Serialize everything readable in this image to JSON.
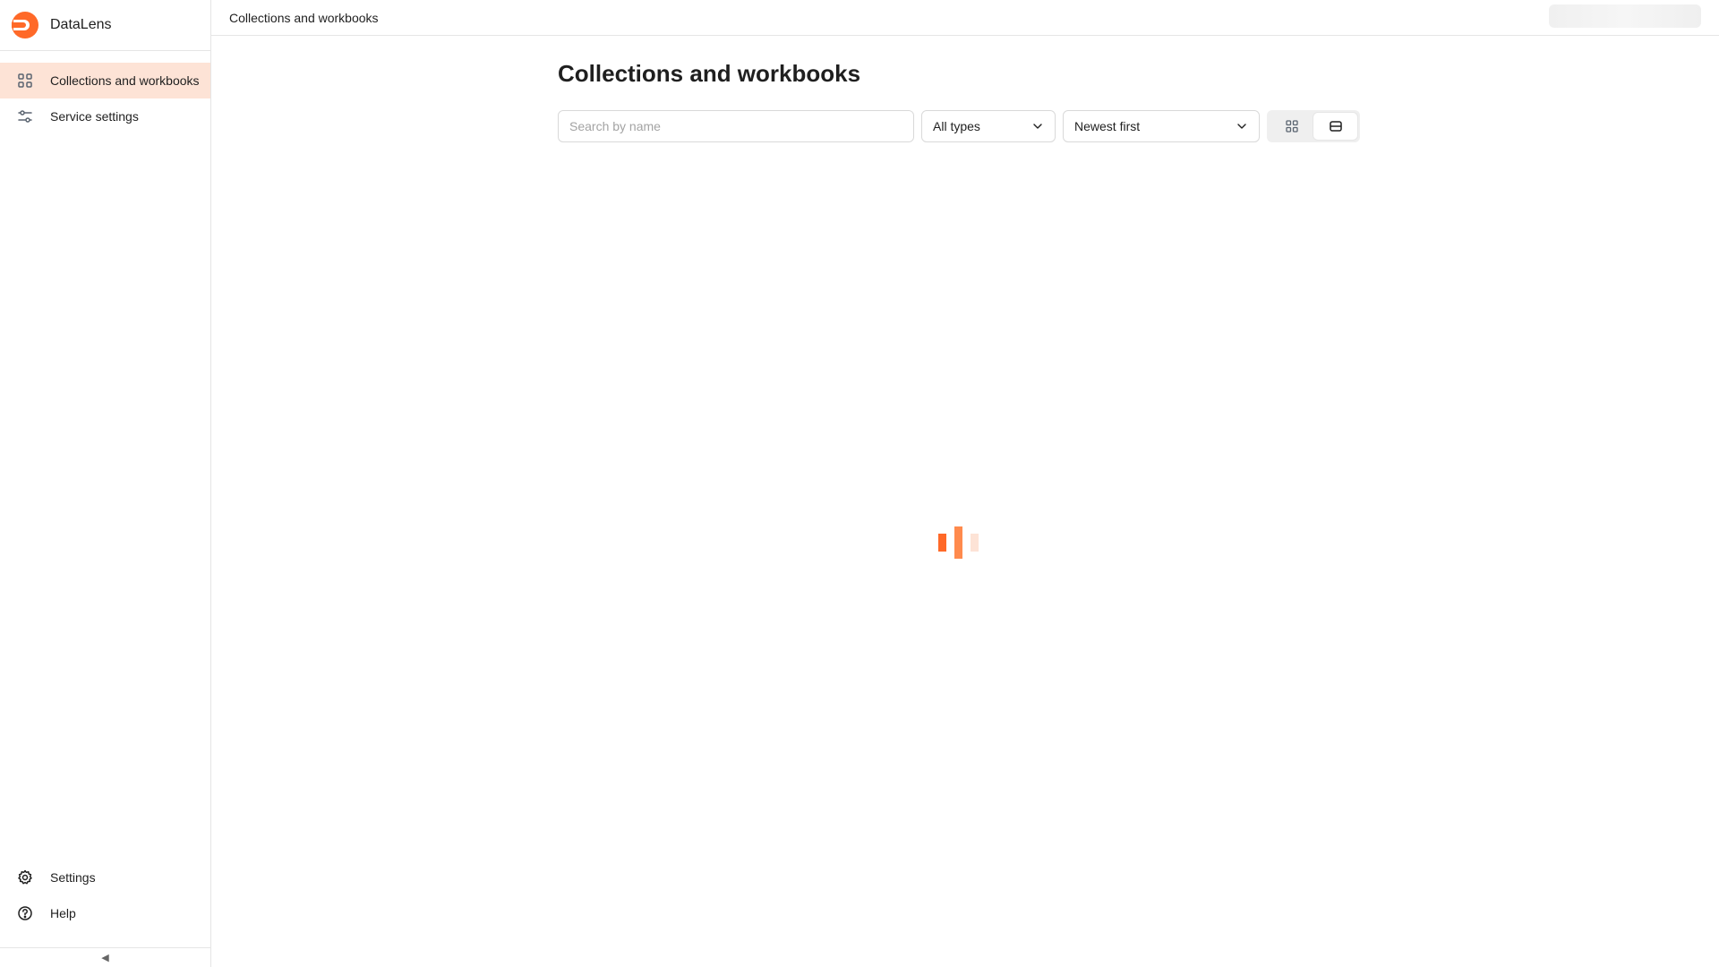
{
  "app": {
    "name": "DataLens"
  },
  "sidebar": {
    "items": [
      {
        "label": "Collections and workbooks",
        "icon": "grid-icon",
        "active": true
      },
      {
        "label": "Service settings",
        "icon": "sliders-icon",
        "active": false
      }
    ],
    "bottom_items": [
      {
        "label": "Settings",
        "icon": "gear-icon"
      },
      {
        "label": "Help",
        "icon": "question-circle-icon"
      }
    ],
    "collapse_glyph": "◀"
  },
  "topbar": {
    "breadcrumb": "Collections and workbooks"
  },
  "main": {
    "title": "Collections and workbooks",
    "search": {
      "placeholder": "Search by name",
      "value": ""
    },
    "type_filter": {
      "selected": "All types"
    },
    "sort": {
      "selected": "Newest first"
    },
    "view_modes": [
      {
        "name": "grid-view",
        "icon": "grid-icon",
        "active": false
      },
      {
        "name": "list-view",
        "icon": "list-icon",
        "active": true
      }
    ]
  },
  "colors": {
    "accent": "#ff6928",
    "active_nav_bg": "#fde3d6",
    "border": "#e5e5e5"
  },
  "loading": true
}
